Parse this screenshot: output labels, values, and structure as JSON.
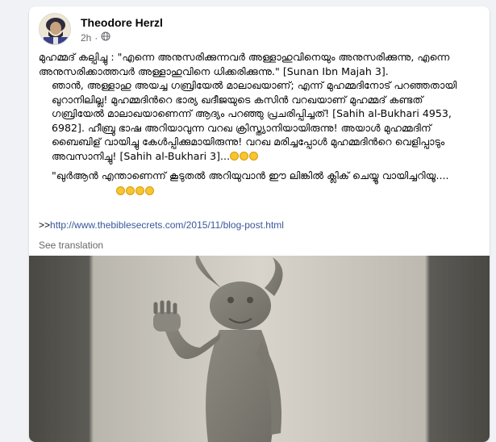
{
  "post": {
    "author": "Theodore Herzl",
    "time": "2h",
    "separator": "·",
    "audience_icon": "globe-icon",
    "paragraphs": [
      "മുഹമ്മദ്  കല്പിച്ചു : \"എന്നെ അനുസരിക്കുന്നവർ അള്ളാഹുവിനെയും അനുസരിക്കുന്നു, എന്നെ അനുസരിക്കാത്തവർ  അള്ളാഹുവിനെ ധിക്കരിക്കുന്നു.\" [Sunan Ibn Majah 3].",
      "ഞാൻ,  അള്ളാഹു അയച്ച ഗബ്രിയേൽ മാലാഖയാണ്; എന്ന് മുഹമ്മദിനോട് പറഞ്ഞതായി ഖുറാനിലില്ല! മുഹമ്മദിൻറെ ഭാര്യ ഖദീജയുടെ  കസിൻ വറഖയാണ്  മുഹമ്മദ് കണ്ടത് ഗബ്രിയേൽ മാലാഖയാണെന്ന് ആദ്യം പറഞ്ഞു പ്രചരിപ്പിച്ചത്! [Sahih al-Bukhari 4953, 6982].  ഹീബ്രു ഭാഷ അറിയാവുന്ന വറഖ ക്രിസ്ത്യാനിയായിരുന്നു!  അയാൾ മുഹമ്മദിന് ബൈബിള് വായിച്ചു കേൾപ്പിക്കുമായിരുന്നു! വറഖ മരിച്ചപ്പോൾ മുഹമ്മദിൻറെ വെളിപ്പാടും അവസാനിച്ചു! [Sahih al-Bukhari 3]...",
      "\"ഖുർആൻ എന്താണെന്ന് കൂടുതൽ അറിയുവാൻ ഈ ലിങ്കിൽ ക്ലിക് ചെയ്യൂ വായിച്ചറിയൂ...."
    ],
    "link_prefix": ">>",
    "link_text": "http://www.thebiblesecrets.com/2015/11/blog-post.html",
    "see_translation": "See translation"
  },
  "colors": {
    "page_background": "#f0f2f5",
    "card_background": "#ffffff",
    "link": "#385898",
    "secondary_text": "#65676b"
  }
}
